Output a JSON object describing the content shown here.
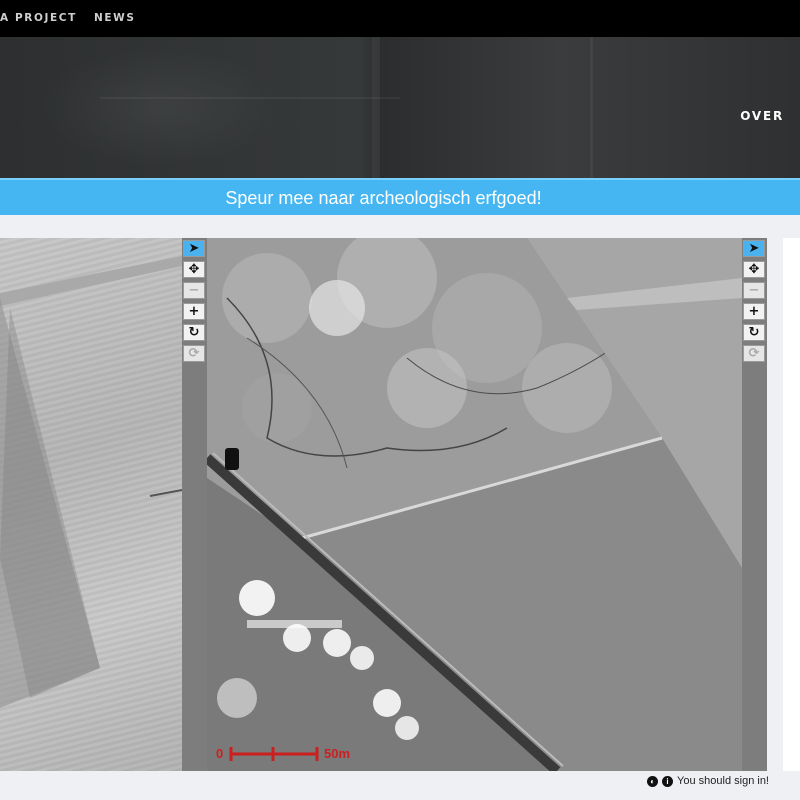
{
  "nav": {
    "items": [
      "A PROJECT",
      "NEWS"
    ]
  },
  "hero": {
    "right_link": "OVER"
  },
  "banner": {
    "text": "Speur mee naar archeologisch erfgoed!"
  },
  "viewer": {
    "toolbar_left": [
      {
        "icon": "pointer-icon",
        "state": "active"
      },
      {
        "icon": "move-icon",
        "state": "normal"
      },
      {
        "icon": "zoom-out-icon",
        "state": "disabled"
      },
      {
        "icon": "zoom-in-icon",
        "state": "normal"
      },
      {
        "icon": "rotate-icon",
        "state": "normal"
      },
      {
        "icon": "reset-rotation-icon",
        "state": "disabled"
      }
    ],
    "scalebar": {
      "start": "0",
      "end": "50m",
      "color": "#cc1f1f"
    }
  },
  "status": {
    "text": "You should sign in!"
  },
  "colors": {
    "accent": "#45b6f1",
    "nav_bg": "#000000"
  }
}
